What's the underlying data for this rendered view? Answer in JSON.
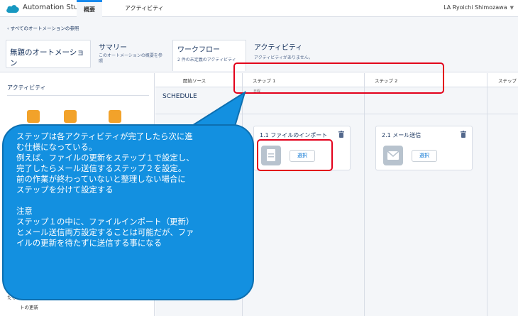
{
  "header": {
    "app_title": "Automation Studio",
    "tabs": [
      "概要",
      "アクティビティ"
    ],
    "user": "LA Ryoichi Shimozawa",
    "brand_color": "#1589ee"
  },
  "subheader": {
    "back_link": "すべてのオートメーションの参照",
    "automation_title": "無題のオートメーション",
    "summary": {
      "title": "サマリー",
      "desc": "このオートメーションの概要を参照"
    },
    "workflow": {
      "title": "ワークフロー",
      "desc": "2 件の未定義のアクティビティ"
    },
    "activity": {
      "title": "アクティビティ",
      "desc": "アクティビティがありません。"
    }
  },
  "left_panel": {
    "heading": "アクティビティ",
    "bottom_text_1": "たも",
    "bottom_text_2": "トの更新"
  },
  "grid": {
    "columns": [
      "開始ソース",
      "ステップ 1",
      "ステップ 2",
      "ステップ"
    ],
    "schedule_label": "SCHEDULE",
    "small_note": "日程"
  },
  "cards": [
    {
      "title": "1.1 ファイルのインポート",
      "button": "選択",
      "icon": "file-icon"
    },
    {
      "title": "2.1 メール送信",
      "button": "選択",
      "icon": "envelope-icon"
    }
  ],
  "callout": {
    "lines": [
      "ステップは各アクティビティが完了したら次に進",
      "む仕様になっている。",
      "例えば、ファイルの更新をステップ１で設定し、",
      "完了したらメール送信するステップ２を設定。",
      "前の作業が終わっていないと整理しない場合に",
      "ステップを分けて設定する",
      "",
      "注意",
      "ステップ１の中に、ファイルインポート（更新）",
      "とメール送信両方設定することは可能だが、ファ",
      "イルの更新を待たずに送信する事になる"
    ],
    "color": "#1390e0"
  },
  "highlight_color": "#e3001b"
}
